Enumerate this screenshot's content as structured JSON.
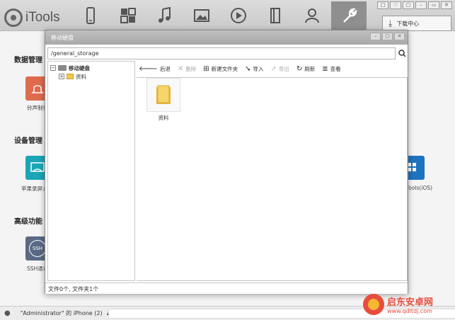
{
  "app": {
    "title": "iTools"
  },
  "window_controls": [
    "□",
    "♡",
    "▢",
    "–",
    "▭",
    "✕"
  ],
  "download_center": {
    "label": "下载中心"
  },
  "nav": [
    "device-icon",
    "apps-icon",
    "music-icon",
    "photo-icon",
    "video-icon",
    "books-icon",
    "contacts-icon",
    "tools-icon"
  ],
  "sections": {
    "data": {
      "title": "数据管理",
      "apps": [
        {
          "label": "铃声制作"
        }
      ]
    },
    "device": {
      "title": "设备管理",
      "apps": [
        {
          "label": "苹果录屏大"
        },
        {
          "label": "Tools(iOS)"
        }
      ]
    },
    "advanced": {
      "title": "高级功能",
      "apps": [
        {
          "label": "SSH通道"
        }
      ]
    }
  },
  "dialog": {
    "title": "移动硬盘",
    "path": "/general_storage",
    "tree": [
      {
        "label": "移动硬盘",
        "toggle": "−"
      },
      {
        "label": "资料",
        "toggle": "+"
      }
    ],
    "toolbar": {
      "back": "后退",
      "delete": "删除",
      "new_folder": "新建文件夹",
      "import": "导入",
      "export": "导出",
      "refresh": "刷新",
      "view": "查看"
    },
    "files": [
      {
        "name": "资料"
      }
    ],
    "status": "文件0个, 文件夹1个"
  },
  "bottom": {
    "device": "\"Administrator\" 的 iPhone (2)",
    "eject": "⏏"
  },
  "watermark": {
    "name": "启东安卓网",
    "url": "www.qdltdj.com"
  },
  "colors": {
    "accent_red": "#e06a4e",
    "accent_teal": "#1aa6b7",
    "accent_blue": "#1e73be",
    "folder_yellow": "#f0c94a"
  }
}
